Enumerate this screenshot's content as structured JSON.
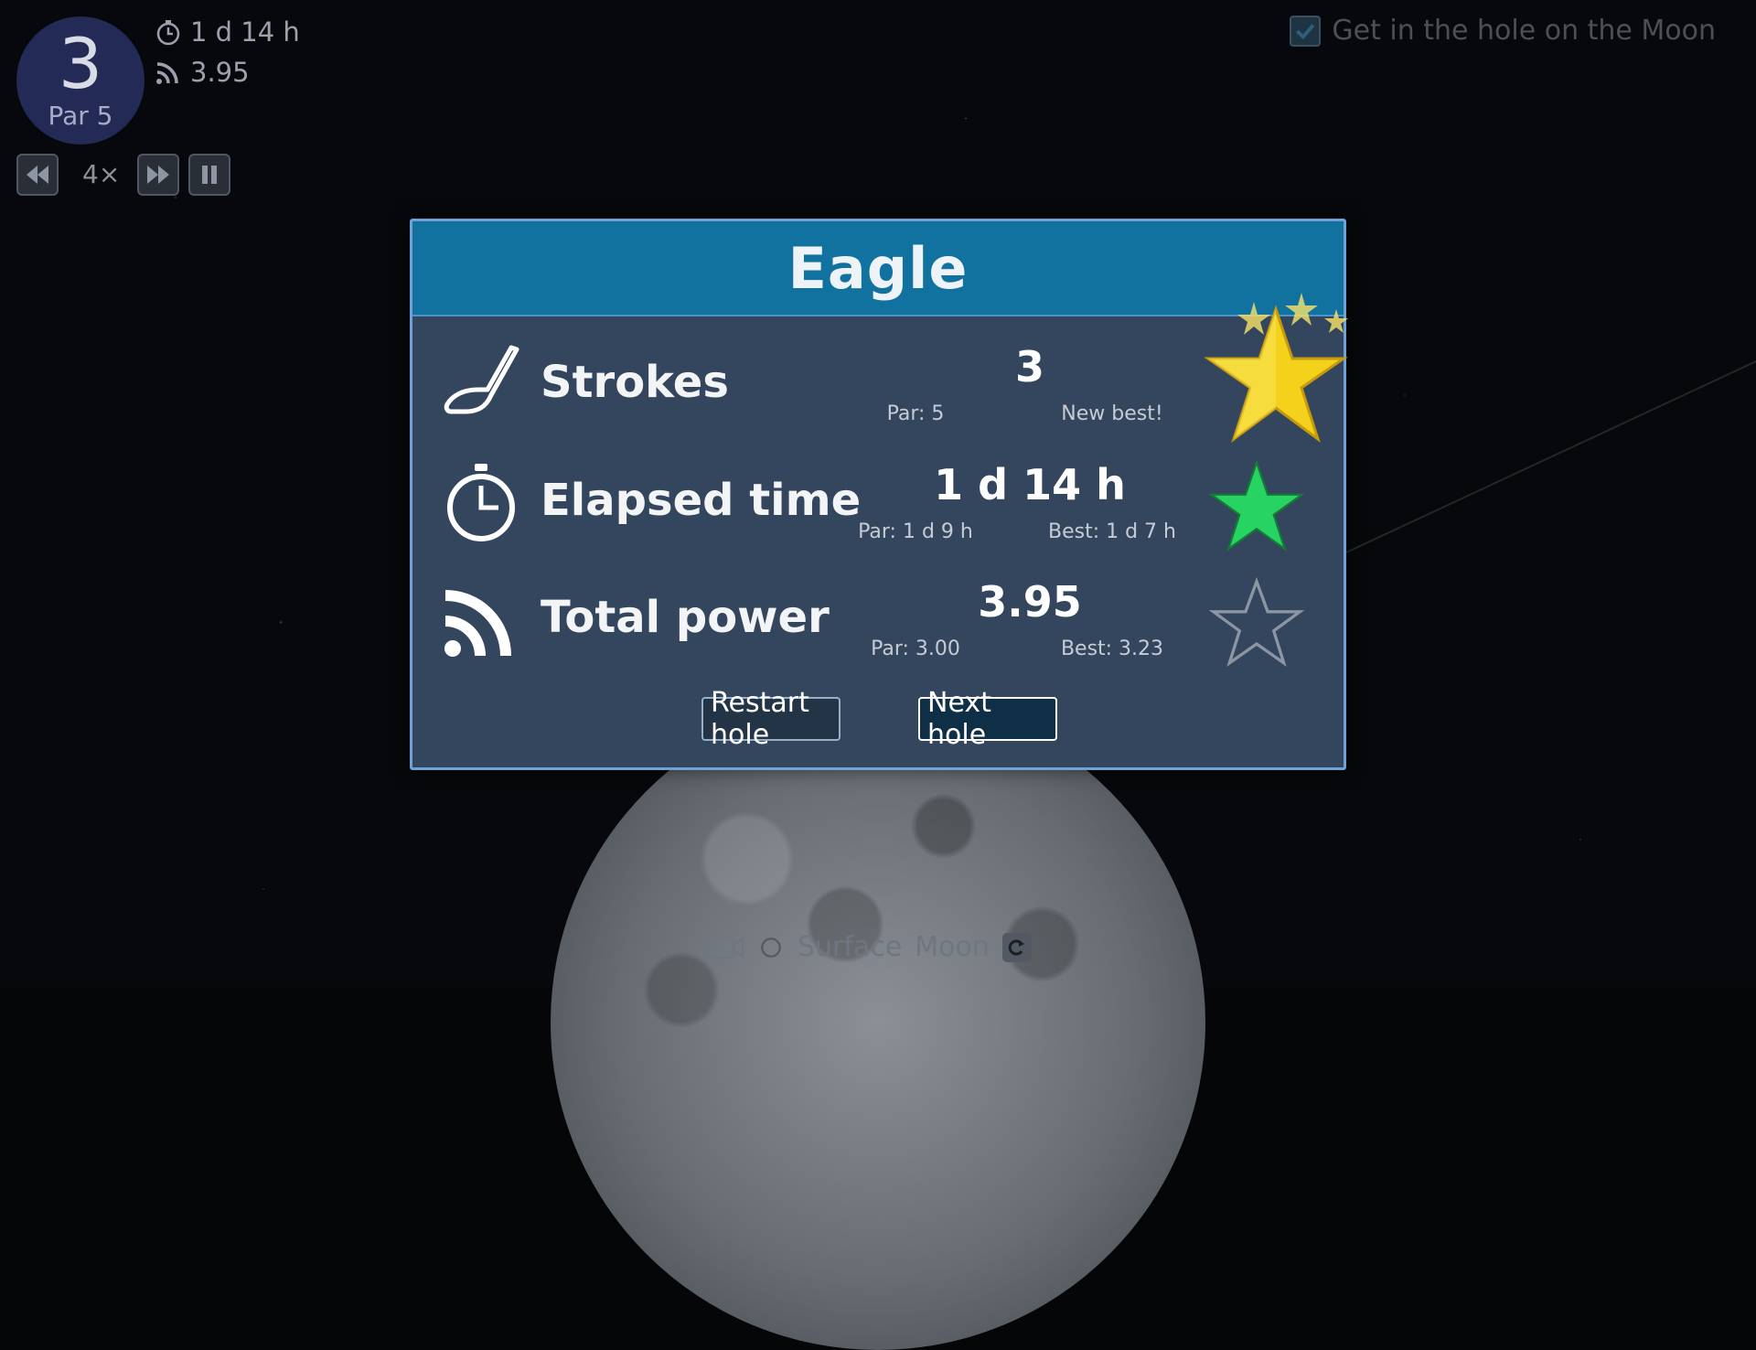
{
  "hud": {
    "hole_number": "3",
    "hole_par": "Par 5",
    "time": "1 d 14 h",
    "power": "3.95",
    "speed": "4×"
  },
  "objective": {
    "text": "Get in the hole on the Moon",
    "checked": true
  },
  "camera_bar": {
    "mode": "Surface",
    "body": "Moon"
  },
  "modal": {
    "title": "Eagle",
    "rows": [
      {
        "label": "Strokes",
        "value": "3",
        "par": "Par: 5",
        "best": "New best!",
        "icon": "golf-club-icon",
        "star": "gold"
      },
      {
        "label": "Elapsed time",
        "value": "1 d 14 h",
        "par": "Par: 1 d 9 h",
        "best": "Best: 1 d 7 h",
        "icon": "stopwatch-icon",
        "star": "green"
      },
      {
        "label": "Total power",
        "value": "3.95",
        "par": "Par: 3.00",
        "best": "Best: 3.23",
        "icon": "power-arcs-icon",
        "star": "empty"
      }
    ],
    "restart_label": "Restart hole",
    "next_label": "Next hole"
  },
  "colors": {
    "header": "#11719f",
    "panel": "#34465d",
    "gold_star": "#f4d21c",
    "green_star": "#27d463"
  }
}
